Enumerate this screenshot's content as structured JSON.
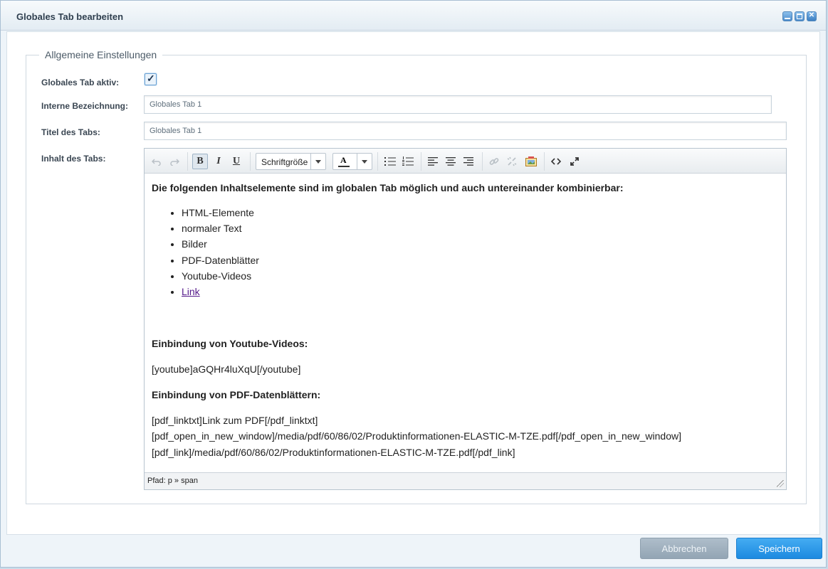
{
  "window": {
    "title": "Globales Tab bearbeiten"
  },
  "fieldset": {
    "legend": "Allgemeine Einstellungen"
  },
  "form": {
    "active_label": "Globales Tab aktiv:",
    "active_checked": true,
    "internal_name_label": "Interne Bezeichnung:",
    "internal_name_value": "Globales Tab 1",
    "tab_title_label": "Titel des Tabs:",
    "tab_title_value": "Globales Tab 1",
    "content_label": "Inhalt des Tabs:"
  },
  "editor": {
    "font_size_select": "Schriftgröße",
    "toolbar_icons": [
      "undo-icon",
      "redo-icon",
      "bold-icon",
      "italic-icon",
      "underline-icon",
      "text-color-icon",
      "bullet-list-icon",
      "numbered-list-icon",
      "align-left-icon",
      "align-center-icon",
      "align-right-icon",
      "link-icon",
      "unlink-icon",
      "image-icon",
      "source-code-icon",
      "fullscreen-icon"
    ],
    "content": {
      "intro": "Die folgenden Inhaltselemente sind im globalen Tab möglich und auch untereinander kombinierbar:",
      "items": [
        "HTML-Elemente",
        "normaler Text",
        "Bilder",
        "PDF-Datenblätter",
        "Youtube-Videos"
      ],
      "link_item": "Link",
      "youtube_heading": "Einbindung von Youtube-Videos:",
      "youtube_code": "[youtube]aGQHr4luXqU[/youtube]",
      "pdf_heading": "Einbindung von PDF-Datenblättern:",
      "pdf_line1": "[pdf_linktxt]Link zum PDF[/pdf_linktxt]",
      "pdf_line2": "[pdf_open_in_new_window]/media/pdf/60/86/02/Produktinformationen-ELASTIC-M-TZE.pdf[/pdf_open_in_new_window]",
      "pdf_line3": "[pdf_link]/media/pdf/60/86/02/Produktinformationen-ELASTIC-M-TZE.pdf[/pdf_link]"
    },
    "status_path": "Pfad: p » span"
  },
  "footer": {
    "cancel_label": "Abbrechen",
    "save_label": "Speichern"
  }
}
